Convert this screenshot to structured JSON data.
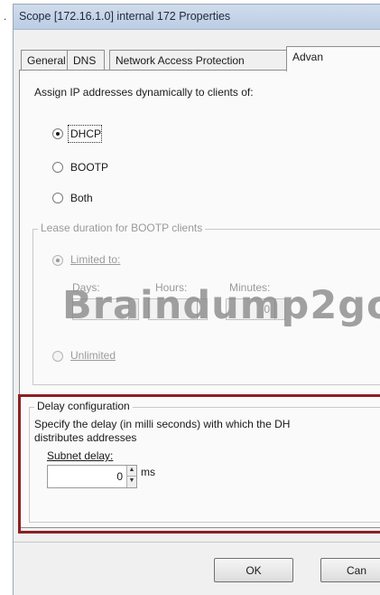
{
  "leading_mark": ".",
  "window": {
    "title_parts": [
      "Scope [172.16.1.0] internal 172 Properties"
    ]
  },
  "tabs": [
    {
      "label": "General",
      "active": false
    },
    {
      "label": "DNS",
      "active": false
    },
    {
      "label": "Network Access Protection",
      "active": false
    },
    {
      "label": "Advan",
      "active": true
    }
  ],
  "assign": {
    "heading": "Assign IP addresses dynamically to clients of:",
    "options": [
      {
        "label": "DHCP",
        "selected": true
      },
      {
        "label": "BOOTP",
        "selected": false
      },
      {
        "label": "Both",
        "selected": false
      }
    ]
  },
  "lease": {
    "legend": "Lease duration for BOOTP clients",
    "limited_label": "Limited to:",
    "days_label": "Days:",
    "hours_label": "Hours:",
    "minutes_label": "Minutes:",
    "minutes_value": "0",
    "unlimited_label": "Unlimited",
    "limited_selected": true
  },
  "watermark": "Braindump2go",
  "delay": {
    "legend": "Delay configuration",
    "description_line1": "Specify the delay (in milli seconds) with which the DH",
    "description_line2": "distributes addresses",
    "subnet_label": "Subnet delay:",
    "value": "0",
    "unit": "ms"
  },
  "footer": {
    "ok_label": "OK",
    "cancel_label": "Can"
  },
  "colors": {
    "highlight_frame": "#8b1f24",
    "titlebar": "#c6d5e8"
  }
}
